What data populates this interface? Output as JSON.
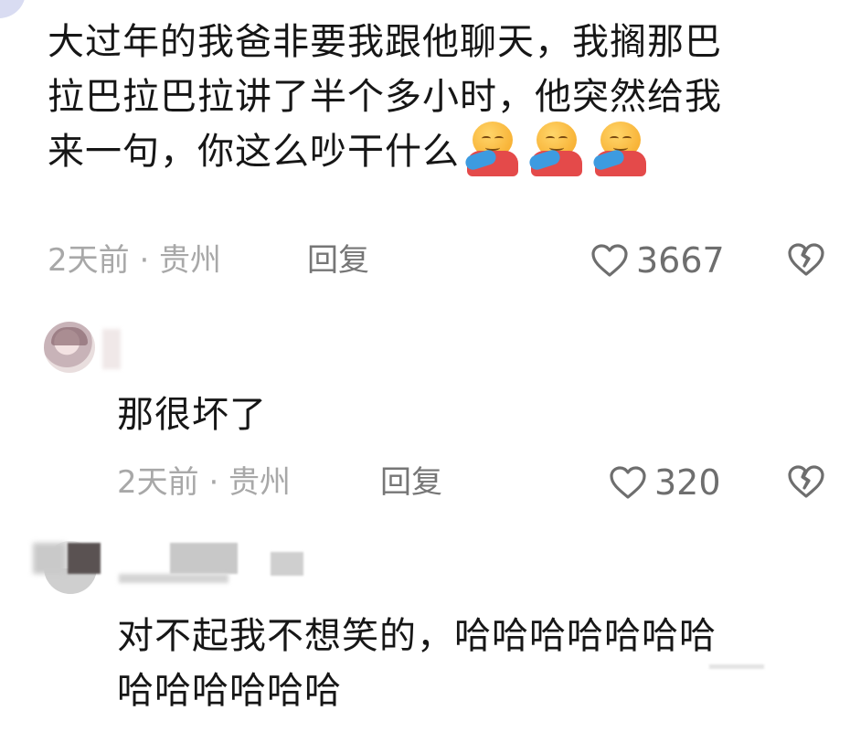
{
  "comments": [
    {
      "text": "大过年的我爸非要我跟他聊天，我搁那巴\n拉巴拉巴拉讲了半个多小时，他突然给我\n来一句，你这么吵干什么",
      "emoji": [
        "hugging-face-emoji",
        "hugging-face-emoji",
        "hugging-face-emoji"
      ],
      "meta": "2天前 · 贵州",
      "reply_label": "回复",
      "likes": "3667"
    },
    {
      "text": "那很坏了",
      "meta": "2天前 · 贵州",
      "reply_label": "回复",
      "likes": "320"
    },
    {
      "text": "对不起我不想笑的，哈哈哈哈哈哈哈\n哈哈哈哈哈哈"
    }
  ],
  "icons": {
    "like": "heart-outline-icon",
    "dislike": "broken-heart-icon"
  },
  "colors": {
    "text": "#161616",
    "meta": "#a8a8a8",
    "icon": "#6e6e6e"
  }
}
